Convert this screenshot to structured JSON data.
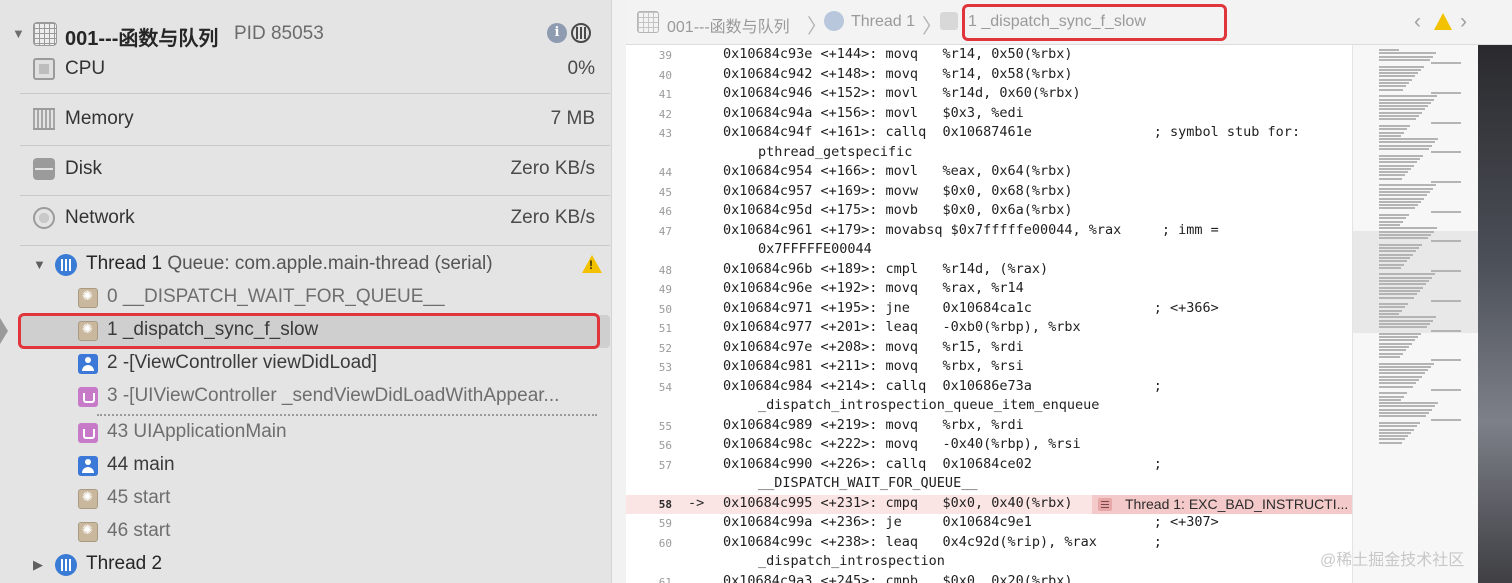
{
  "process": {
    "name": "001---函数与队列",
    "pid": "PID 85053"
  },
  "gauges": [
    {
      "label": "CPU",
      "value": "0%",
      "icon": "cpu-icon"
    },
    {
      "label": "Memory",
      "value": "7 MB",
      "icon": "memory-icon"
    },
    {
      "label": "Disk",
      "value": "Zero KB/s",
      "icon": "disk-icon"
    },
    {
      "label": "Network",
      "value": "Zero KB/s",
      "icon": "network-icon"
    }
  ],
  "thread1": {
    "name": "Thread 1",
    "queue": "Queue: com.apple.main-thread (serial)"
  },
  "frames": [
    "0 __DISPATCH_WAIT_FOR_QUEUE__",
    "1 _dispatch_sync_f_slow",
    "2 -[ViewController viewDidLoad]",
    "3 -[UIViewController _sendViewDidLoadWithAppear...",
    "43 UIApplicationMain",
    "44 main",
    "45 start",
    "46 start"
  ],
  "thread2": {
    "name": "Thread 2"
  },
  "jumpbar": {
    "project": "001---函数与队列",
    "thread": "Thread 1",
    "frame": "1 _dispatch_sync_f_slow"
  },
  "code_lines": [
    {
      "n": "39",
      "text": "0x10684c93e <+144>: movq   %r14, 0x50(%rbx)"
    },
    {
      "n": "40",
      "text": "0x10684c942 <+148>: movq   %r14, 0x58(%rbx)"
    },
    {
      "n": "41",
      "text": "0x10684c946 <+152>: movl   %r14d, 0x60(%rbx)"
    },
    {
      "n": "42",
      "text": "0x10684c94a <+156>: movl   $0x3, %edi"
    },
    {
      "n": "43",
      "text": "0x10684c94f <+161>: callq  0x10687461e               ; symbol stub for:"
    },
    {
      "n": "",
      "text": "pthread_getspecific",
      "cont": true
    },
    {
      "n": "44",
      "text": "0x10684c954 <+166>: movl   %eax, 0x64(%rbx)"
    },
    {
      "n": "45",
      "text": "0x10684c957 <+169>: movw   $0x0, 0x68(%rbx)"
    },
    {
      "n": "46",
      "text": "0x10684c95d <+175>: movb   $0x0, 0x6a(%rbx)"
    },
    {
      "n": "47",
      "text": "0x10684c961 <+179>: movabsq $0x7fffffe00044, %rax     ; imm ="
    },
    {
      "n": "",
      "text": "0x7FFFFFE00044",
      "cont": true
    },
    {
      "n": "48",
      "text": "0x10684c96b <+189>: cmpl   %r14d, (%rax)"
    },
    {
      "n": "49",
      "text": "0x10684c96e <+192>: movq   %rax, %r14"
    },
    {
      "n": "50",
      "text": "0x10684c971 <+195>: jne    0x10684ca1c               ; <+366>"
    },
    {
      "n": "51",
      "text": "0x10684c977 <+201>: leaq   -0xb0(%rbp), %rbx"
    },
    {
      "n": "52",
      "text": "0x10684c97e <+208>: movq   %r15, %rdi"
    },
    {
      "n": "53",
      "text": "0x10684c981 <+211>: movq   %rbx, %rsi"
    },
    {
      "n": "54",
      "text": "0x10684c984 <+214>: callq  0x10686e73a               ;"
    },
    {
      "n": "",
      "text": "_dispatch_introspection_queue_item_enqueue",
      "cont": true
    },
    {
      "n": "55",
      "text": "0x10684c989 <+219>: movq   %rbx, %rdi"
    },
    {
      "n": "56",
      "text": "0x10684c98c <+222>: movq   -0x40(%rbp), %rsi"
    },
    {
      "n": "57",
      "text": "0x10684c990 <+226>: callq  0x10684ce02               ;"
    },
    {
      "n": "",
      "text": "__DISPATCH_WAIT_FOR_QUEUE__",
      "cont": true
    },
    {
      "n": "58",
      "text": "0x10684c995 <+231>: cmpq   $0x0, 0x40(%rbx)",
      "current": true,
      "arrow": "->"
    },
    {
      "n": "59",
      "text": "0x10684c99a <+236>: je     0x10684c9e1               ; <+307>"
    },
    {
      "n": "60",
      "text": "0x10684c99c <+238>: leaq   0x4c92d(%rip), %rax       ;"
    },
    {
      "n": "",
      "text": "_dispatch_introspection",
      "cont": true
    },
    {
      "n": "61",
      "text": "0x10684c9a3 <+245>: cmpb   $0x0, 0x20(%rbx)"
    }
  ],
  "error_badge": "Thread 1: EXC_BAD_INSTRUCTI...",
  "watermark": "@稀土掘金技术社区",
  "colors": {
    "highlight_box": "#e0353a",
    "current_line": "#fbe4e4",
    "thread_icon": "#3a7bd5",
    "warning": "#f2c200"
  }
}
